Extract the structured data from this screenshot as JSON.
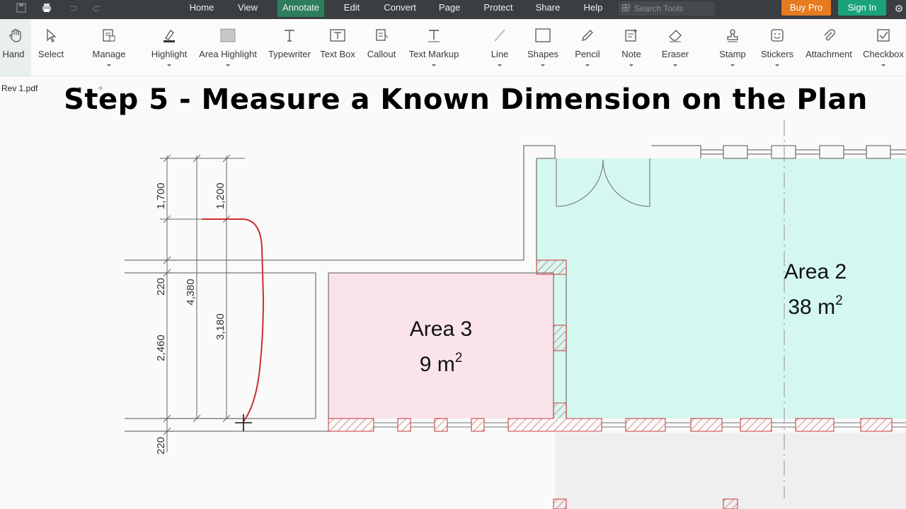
{
  "app": {
    "menu": [
      "Home",
      "View",
      "Annotate",
      "Edit",
      "Convert",
      "Page",
      "Protect",
      "Share",
      "Help"
    ],
    "active_menu": "Annotate",
    "search_placeholder": "Search Tools",
    "buy_pro": "Buy Pro",
    "sign_in": "Sign In"
  },
  "toolbar": {
    "tools": [
      {
        "label": "Hand",
        "icon": "hand-icon"
      },
      {
        "label": "Select",
        "icon": "cursor-icon"
      },
      {
        "label": "Manage",
        "icon": "manage-icon"
      },
      {
        "label": "Highlight",
        "icon": "highlighter-icon"
      },
      {
        "label": "Area Highlight",
        "icon": "area-highlight-icon"
      },
      {
        "label": "Typewriter",
        "icon": "typewriter-icon"
      },
      {
        "label": "Text Box",
        "icon": "textbox-icon"
      },
      {
        "label": "Callout",
        "icon": "callout-icon"
      },
      {
        "label": "Text Markup",
        "icon": "text-markup-icon"
      },
      {
        "label": "Line",
        "icon": "line-icon"
      },
      {
        "label": "Shapes",
        "icon": "shapes-icon"
      },
      {
        "label": "Pencil",
        "icon": "pencil-icon"
      },
      {
        "label": "Note",
        "icon": "note-icon"
      },
      {
        "label": "Eraser",
        "icon": "eraser-icon"
      },
      {
        "label": "Stamp",
        "icon": "stamp-icon"
      },
      {
        "label": "Stickers",
        "icon": "stickers-icon"
      },
      {
        "label": "Attachment",
        "icon": "paperclip-icon"
      },
      {
        "label": "Checkbox",
        "icon": "checkbox-icon"
      }
    ]
  },
  "document": {
    "filename": "Rev 1.pdf"
  },
  "overlay": {
    "heading": "Step 5 - Measure a Known Dimension on the Plan"
  },
  "plan": {
    "dimensions": {
      "d1700": "1,700",
      "d1200": "1,200",
      "d220a": "220",
      "d4380": "4,380",
      "d3180": "3,180",
      "d2460": "2,460",
      "d220b": "220"
    },
    "areas": [
      {
        "name": "Area 3",
        "value": "9 m",
        "sup": "2",
        "color": "#fbe3ea"
      },
      {
        "name": "Area 2",
        "value": "38 m",
        "sup": "2",
        "color": "#d4f7ef"
      }
    ]
  },
  "colors": {
    "accent": "#2e7d5b",
    "buy_pro": "#e77b1f",
    "sign_in": "#1aa37a",
    "markup": "#cc2e2e"
  }
}
